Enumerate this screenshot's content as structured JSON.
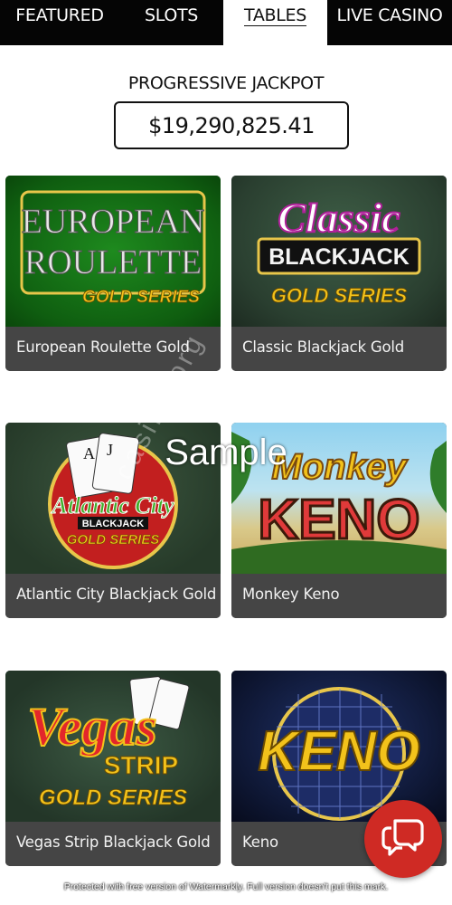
{
  "nav": {
    "tabs": [
      {
        "label": "FEATURED"
      },
      {
        "label": "SLOTS"
      },
      {
        "label": "TABLES",
        "active": true
      },
      {
        "label": "LIVE CASINO"
      }
    ]
  },
  "jackpot": {
    "title": "PROGRESSIVE JACKPOT",
    "amount": "$19,290,825.41"
  },
  "games": [
    {
      "label": "European Roulette Gold",
      "art": [
        "EUROPEAN",
        "ROULETTE",
        "GOLD SERIES"
      ]
    },
    {
      "label": "Classic Blackjack Gold",
      "art": [
        "Classic",
        "BLACKJACK",
        "GOLD SERIES"
      ]
    },
    {
      "label": "Atlantic City Blackjack Gold",
      "art": [
        "Atlantic City",
        "BLACKJACK",
        "GOLD SERIES"
      ]
    },
    {
      "label": "Monkey Keno",
      "art": [
        "Monkey",
        "KENO"
      ]
    },
    {
      "label": "Vegas Strip Blackjack Gold",
      "art": [
        "Vegas",
        "STRIP",
        "GOLD SERIES"
      ]
    },
    {
      "label": "Keno",
      "art": [
        "KENO"
      ]
    }
  ],
  "watermarks": {
    "sample": "Sample",
    "diagonal": "casino.org",
    "footer": "Protected with free version of Watermarkly. Full version doesn't put this mark."
  },
  "colors": {
    "nav_bg": "#050505",
    "label_bg": "#454545",
    "chat_button": "#cf2a24",
    "gold": "#f2c21b"
  },
  "icons": {
    "chat": "chat-bubbles-icon"
  }
}
